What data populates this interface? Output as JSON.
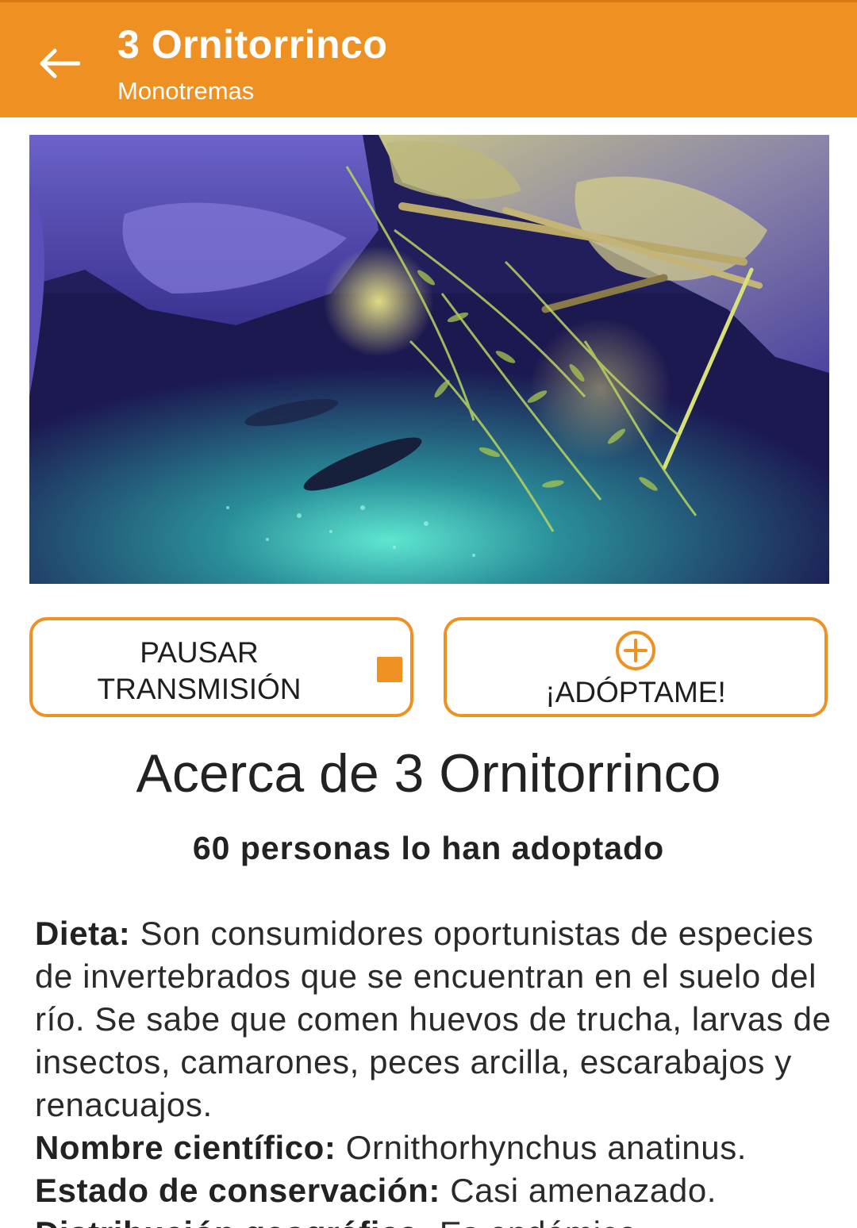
{
  "header": {
    "back_icon": "arrow-left-icon",
    "title": "3 Ornitorrinco",
    "subtitle": "Monotremas",
    "color": "#ef9022"
  },
  "video": {
    "description_icon": "live-stream-image"
  },
  "actions": {
    "pause_label": "PAUSAR\nTRANSMISIÓN",
    "pause_icon": "stop-icon",
    "adopt_label": "¡ADÓPTAME!",
    "adopt_icon": "plus-circle-icon"
  },
  "about": {
    "title": "Acerca de 3 Ornitorrinco",
    "adopted_count": "60 personas lo han adoptado",
    "diet_label": "Dieta:",
    "diet_text": " Son consumidores oportunistas de especies de invertebrados que se encuentran en el suelo del río. Se sabe que comen huevos de trucha, larvas de insectos, camarones, peces arcilla, escarabajos y renacuajos.",
    "scientific_label": "Nombre científico:",
    "scientific_text": " Ornithorhynchus anatinus.",
    "conservation_label": "Estado de conservación:",
    "conservation_text": " Casi amenazado.",
    "distribution_label": "Distribución geográfica:",
    "distribution_text": " Es endémico"
  }
}
